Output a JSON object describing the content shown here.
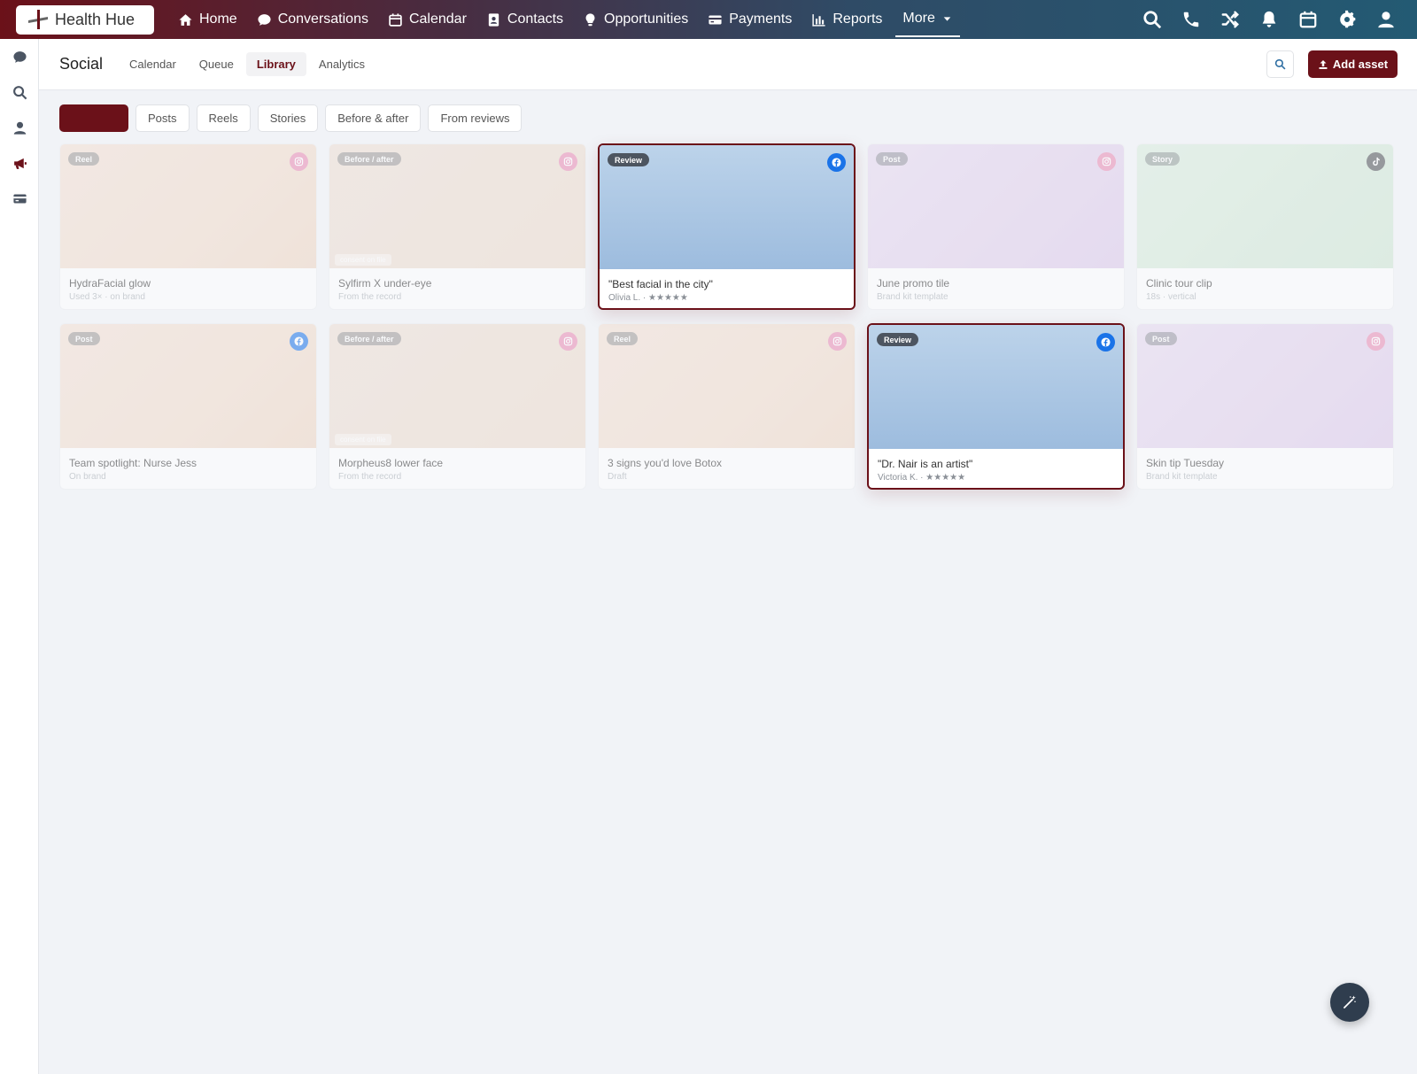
{
  "app": {
    "brand": "Health Hue"
  },
  "topnav": {
    "items": [
      {
        "label": "Home",
        "icon": "home-icon"
      },
      {
        "label": "Conversations",
        "icon": "chat-icon"
      },
      {
        "label": "Calendar",
        "icon": "calendar-icon"
      },
      {
        "label": "Contacts",
        "icon": "contact-card-icon"
      },
      {
        "label": "Opportunities",
        "icon": "lightbulb-icon"
      },
      {
        "label": "Payments",
        "icon": "credit-card-icon"
      },
      {
        "label": "Reports",
        "icon": "bar-chart-icon"
      }
    ],
    "more_label": "More",
    "right_icons": [
      "search-icon",
      "phone-icon",
      "shuffle-icon",
      "bell-icon",
      "calendar-icon",
      "gear-icon",
      "user-icon"
    ]
  },
  "sidebar": {
    "icons": [
      "chat-icon",
      "search-icon",
      "user-icon",
      "megaphone-icon",
      "credit-card-icon"
    ],
    "active": "megaphone-icon"
  },
  "subheader": {
    "title": "Social",
    "tabs": [
      {
        "label": "Calendar",
        "active": false
      },
      {
        "label": "Queue",
        "active": false
      },
      {
        "label": "Library",
        "active": true
      },
      {
        "label": "Analytics",
        "active": false
      }
    ],
    "add_asset_label": "Add asset"
  },
  "filters": {
    "chips": [
      {
        "label": "",
        "active": true
      },
      {
        "label": "Posts",
        "active": false
      },
      {
        "label": "Reels",
        "active": false
      },
      {
        "label": "Stories",
        "active": false
      },
      {
        "label": "Before & after",
        "active": false
      },
      {
        "label": "From reviews",
        "active": false
      }
    ]
  },
  "library": {
    "cards": [
      {
        "type": "Reel",
        "platform": "instagram",
        "title": "HydraFacial glow",
        "sub": "Used 3× · on brand",
        "theme": "peach",
        "highlighted": false,
        "consent": ""
      },
      {
        "type": "Before / after",
        "platform": "instagram",
        "title": "Sylfirm X under-eye",
        "sub": "From the record",
        "theme": "beige",
        "highlighted": false,
        "consent": "consent on file"
      },
      {
        "type": "Review",
        "platform": "facebook",
        "title": "\"Best facial in the city\"",
        "sub": "Olivia L. · ★★★★★",
        "theme": "blue",
        "highlighted": true,
        "consent": ""
      },
      {
        "type": "Post",
        "platform": "instagram",
        "title": "June promo tile",
        "sub": "Brand kit template",
        "theme": "lilac",
        "highlighted": false,
        "consent": ""
      },
      {
        "type": "Story",
        "platform": "tiktok",
        "title": "Clinic tour clip",
        "sub": "18s · vertical",
        "theme": "mint",
        "highlighted": false,
        "consent": ""
      },
      {
        "type": "Post",
        "platform": "facebook",
        "title": "Team spotlight: Nurse Jess",
        "sub": "On brand",
        "theme": "peach",
        "highlighted": false,
        "consent": ""
      },
      {
        "type": "Before / after",
        "platform": "instagram",
        "title": "Morpheus8 lower face",
        "sub": "From the record",
        "theme": "beige",
        "highlighted": false,
        "consent": "consent on file"
      },
      {
        "type": "Reel",
        "platform": "instagram",
        "title": "3 signs you'd love Botox",
        "sub": "Draft",
        "theme": "peach",
        "highlighted": false,
        "consent": ""
      },
      {
        "type": "Review",
        "platform": "facebook",
        "title": "\"Dr. Nair is an artist\"",
        "sub": "Victoria K. · ★★★★★",
        "theme": "blue",
        "highlighted": true,
        "consent": ""
      },
      {
        "type": "Post",
        "platform": "instagram",
        "title": "Skin tip Tuesday",
        "sub": "Brand kit template",
        "theme": "lilac",
        "highlighted": false,
        "consent": ""
      }
    ]
  },
  "colors": {
    "brand": "#6b1119",
    "instagram": "#e98ab3",
    "facebook": "#1a73e8",
    "tiktok": "#4d5054"
  }
}
